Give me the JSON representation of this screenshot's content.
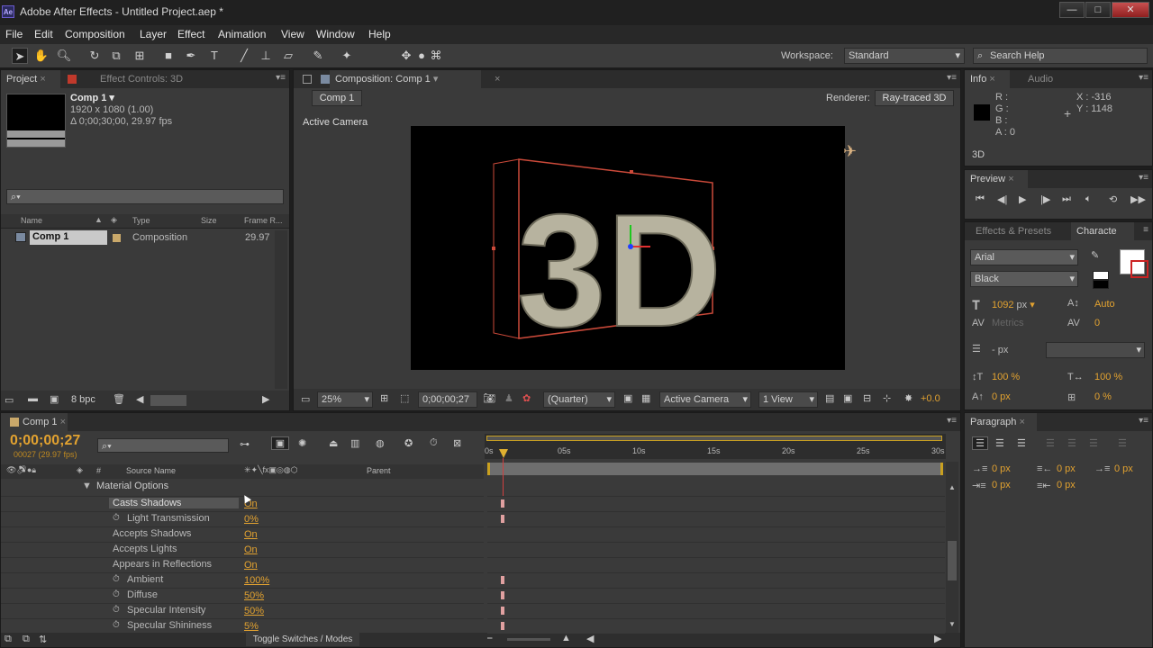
{
  "title_bar": {
    "app_icon": "Ae",
    "title": "Adobe After Effects - Untitled Project.aep *"
  },
  "menu": [
    "File",
    "Edit",
    "Composition",
    "Layer",
    "Effect",
    "Animation",
    "View",
    "Window",
    "Help"
  ],
  "toolbar": {
    "workspace_label": "Workspace:",
    "workspace_value": "Standard",
    "search_placeholder": "Search Help",
    "tools": [
      "selection-tool-icon",
      "hand-tool-icon",
      "zoom-tool-icon",
      "rotate-tool-icon",
      "camera-tool-icon",
      "pan-behind-icon",
      "rectangle-tool-icon",
      "pen-tool-icon",
      "type-tool-icon",
      "brush-tool-icon",
      "clone-stamp-icon",
      "eraser-tool-icon",
      "roto-brush-icon",
      "puppet-pin-icon"
    ]
  },
  "project_panel": {
    "tab_project": "Project",
    "tab_effect_controls": "Effect Controls: 3D",
    "comp_name": "Comp 1 ▾",
    "comp_size": "1920 x 1080 (1.00)",
    "comp_duration": "Δ 0;00;30;00, 29.97 fps",
    "search_placeholder": "",
    "columns": [
      "Name",
      "Type",
      "Size",
      "Frame R..."
    ],
    "items": [
      {
        "name": "Comp 1",
        "type": "Composition",
        "size": "",
        "frame_rate": "29.97"
      }
    ],
    "bpc": "8 bpc"
  },
  "comp_panel": {
    "tab": "Composition: Comp 1",
    "breadcrumb": "Comp 1",
    "renderer_label": "Renderer:",
    "renderer_value": "Ray-traced 3D",
    "view_label": "Active Camera",
    "text_3d": "3D",
    "footer": {
      "zoom": "25%",
      "timecode": "0;00;00;27",
      "resolution": "(Quarter)",
      "camera": "Active Camera",
      "views": "1 View",
      "exposure": "+0.0"
    }
  },
  "info_panel": {
    "tab_info": "Info",
    "tab_audio": "Audio",
    "r": "R :",
    "g": "G :",
    "b": "B :",
    "a": "A : 0",
    "x": "X : -316",
    "y": "Y : 1148",
    "layer": "3D"
  },
  "preview_panel": {
    "tab": "Preview"
  },
  "character_panel": {
    "tab_effects": "Effects & Presets",
    "tab_character": "Characte",
    "font": "Arial",
    "style": "Black",
    "size": "1092",
    "size_unit": "px",
    "leading": "Auto",
    "kerning": "Metrics",
    "tracking": "0",
    "stroke_unit": "- px",
    "vscale": "100 %",
    "hscale": "100 %",
    "baseline": "0 px",
    "tsume": "0 %"
  },
  "paragraph_panel": {
    "tab": "Paragraph",
    "indent_left": "0 px",
    "indent_first": "0 px",
    "indent_right": "0 px",
    "space_before": "0 px",
    "space_after": "0 px"
  },
  "timeline": {
    "tab": "Comp 1",
    "timecode": "0;00;00;27",
    "frames": "00027 (29.97 fps)",
    "col_source": "Source Name",
    "col_parent": "Parent",
    "ruler": [
      "0s",
      "05s",
      "10s",
      "15s",
      "20s",
      "25s",
      "30s"
    ],
    "toggle_label": "Toggle Switches / Modes",
    "group": "Material Options",
    "props": [
      {
        "name": "Casts Shadows",
        "value": "On",
        "stopwatch": false,
        "highlight": true,
        "key": true
      },
      {
        "name": "Light Transmission",
        "value": "0%",
        "stopwatch": true,
        "highlight": false,
        "key": true
      },
      {
        "name": "Accepts Shadows",
        "value": "On",
        "stopwatch": false,
        "highlight": false,
        "key": false
      },
      {
        "name": "Accepts Lights",
        "value": "On",
        "stopwatch": false,
        "highlight": false,
        "key": false
      },
      {
        "name": "Appears in Reflections",
        "value": "On",
        "stopwatch": false,
        "highlight": false,
        "key": false
      },
      {
        "name": "Ambient",
        "value": "100%",
        "stopwatch": true,
        "highlight": false,
        "key": true
      },
      {
        "name": "Diffuse",
        "value": "50%",
        "stopwatch": true,
        "highlight": false,
        "key": true
      },
      {
        "name": "Specular Intensity",
        "value": "50%",
        "stopwatch": true,
        "highlight": false,
        "key": true
      },
      {
        "name": "Specular Shininess",
        "value": "5%",
        "stopwatch": true,
        "highlight": false,
        "key": true
      }
    ]
  }
}
